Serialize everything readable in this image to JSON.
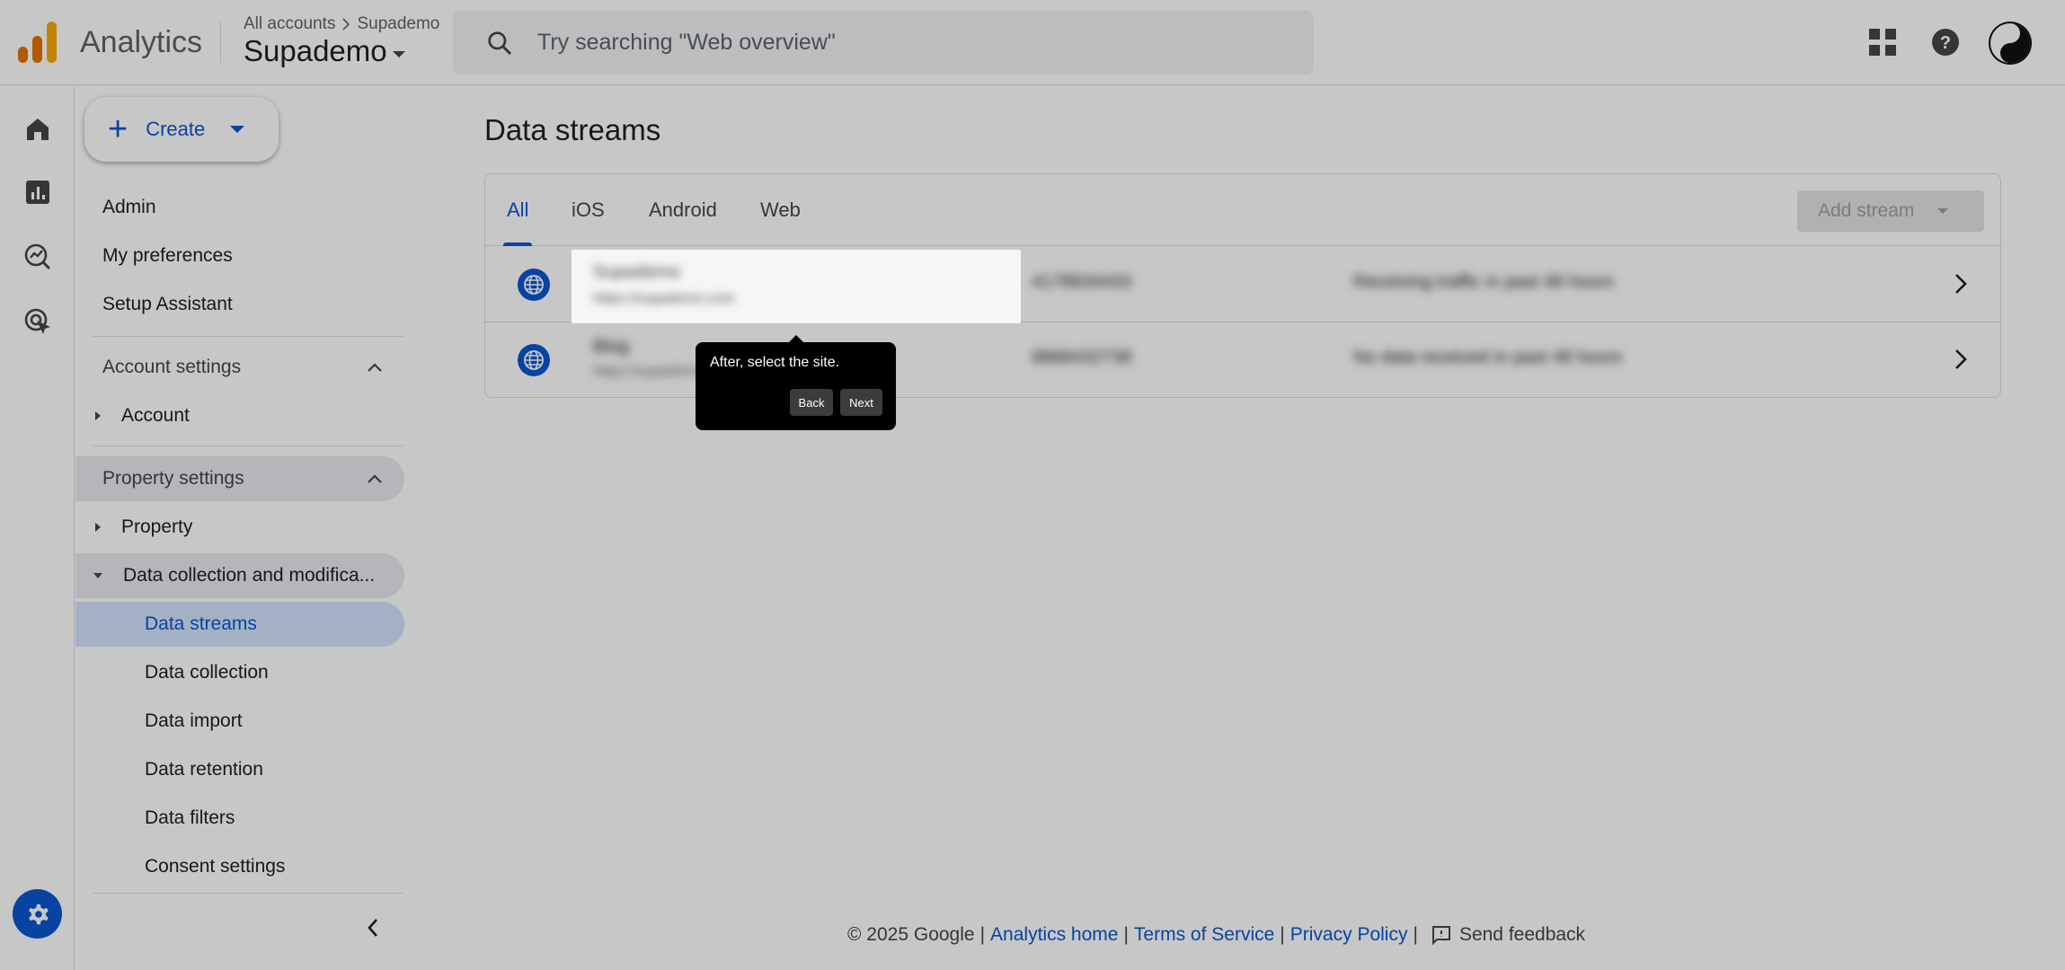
{
  "header": {
    "app_name": "Analytics",
    "breadcrumb_root": "All accounts",
    "breadcrumb_account": "Supademo",
    "property_name": "Supademo",
    "search_placeholder": "Try searching \"Web overview\""
  },
  "sidenav": {
    "create_label": "Create",
    "top_items": [
      "Admin",
      "My preferences",
      "Setup Assistant"
    ],
    "account_settings": {
      "label": "Account settings",
      "items": [
        "Account"
      ]
    },
    "property_settings": {
      "label": "Property settings",
      "property_label": "Property",
      "data_collection_label": "Data collection and modifica...",
      "sub_items": [
        "Data streams",
        "Data collection",
        "Data import",
        "Data retention",
        "Data filters",
        "Consent settings"
      ]
    }
  },
  "main": {
    "title": "Data streams",
    "tabs": [
      "All",
      "iOS",
      "Android",
      "Web"
    ],
    "active_tab": "All",
    "add_stream_label": "Add stream",
    "streams": [
      {
        "name": "Supademo",
        "url": "https://supademo.com",
        "id": "4178834433",
        "status": "Receiving traffic in past 48 hours"
      },
      {
        "name": "Blog",
        "url": "https://supademo.com",
        "id": "8868432738",
        "status": "No data received in past 48 hours"
      }
    ]
  },
  "tooltip": {
    "message": "After, select the site.",
    "back_label": "Back",
    "next_label": "Next"
  },
  "footer": {
    "copyright": "© 2025 Google",
    "link_home": "Analytics home",
    "link_terms": "Terms of Service",
    "link_privacy": "Privacy Policy",
    "feedback": "Send feedback"
  },
  "colors": {
    "accent": "#0b57d0",
    "logo_orange": "#e37400",
    "logo_yellow": "#f9ab00"
  }
}
